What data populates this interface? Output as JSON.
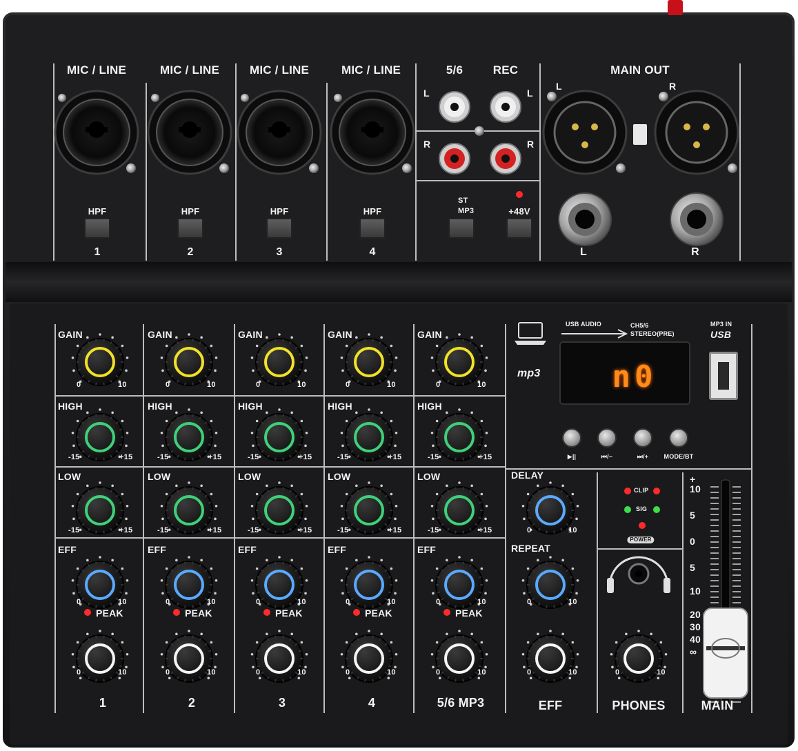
{
  "top_panel": {
    "input_label": "MIC / LINE",
    "hpf_label": "HPF",
    "channels": [
      "1",
      "2",
      "3",
      "4"
    ],
    "ch56_label": "5/6",
    "rec_label": "REC",
    "l_label": "L",
    "r_label": "R",
    "st_label": "ST",
    "mp3_label": "MP3",
    "phantom_label": "+48V",
    "main_out_label": "MAIN OUT"
  },
  "channel_strip": {
    "gain_label": "GAIN",
    "high_label": "HIGH",
    "low_label": "LOW",
    "eff_label": "EFF",
    "peak_label": "PEAK",
    "min_zero": "0",
    "max_ten": "10",
    "eq_min": "-15",
    "eq_max": "+15",
    "names": [
      "1",
      "2",
      "3",
      "4",
      "5/6 MP3"
    ]
  },
  "mp3_section": {
    "usb_audio_label": "USB AUDIO",
    "ch56_label": "CH5/6",
    "stereo_pre_label": "STEREO(PRE)",
    "mp3_in_label": "MP3 IN",
    "usb_label": "USB",
    "mp3_logo": "mp3",
    "display_value": "n0",
    "btn_labels": [
      "▶||",
      "⏮/−",
      "⏭/+",
      "MODE/BT"
    ]
  },
  "fx_section": {
    "delay_label": "DELAY",
    "repeat_label": "REPEAT",
    "eff_label": "EFF"
  },
  "meter_section": {
    "clip_label": "CLIP",
    "sig_label": "SIG",
    "power_label": "POWER",
    "phones_label": "PHONES"
  },
  "fader": {
    "scale": [
      "+",
      "10",
      "5",
      "0",
      "5",
      "10",
      "20",
      "30",
      "40",
      "∞"
    ],
    "main_label": "MAIN"
  },
  "colors": {
    "body": "#1c1c1e",
    "gain_ring": "#f2e227",
    "eq_ring": "#3fd07a",
    "eff_ring": "#5aa9ff",
    "level_ring": "#f5f5f5",
    "led_red": "#ff2a2a",
    "led_green": "#3ce04a",
    "display": "#ff8c1a"
  }
}
